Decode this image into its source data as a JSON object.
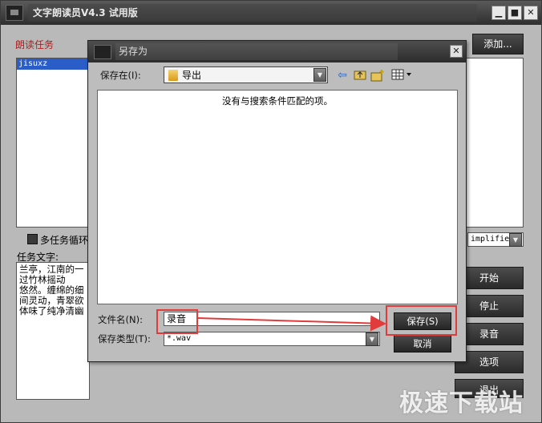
{
  "main_window": {
    "title": "文字朗读员V4.3 试用版",
    "task_section_label": "朗读任务",
    "tasks": [
      "jisuxz"
    ],
    "add_button": "添加...",
    "loop_label": "多任务循环",
    "voice_select_value": "implifie",
    "task_text_label": "任务文字:",
    "task_text": "兰亭，江南的一\n过竹林摇动\n悠然。缠绵的细\n间灵动，青翠欲\n体味了纯净清幽",
    "buttons": {
      "start": "开始",
      "stop": "停止",
      "record": "录音",
      "options": "选项",
      "partial": "退出"
    },
    "window_controls": {
      "minimize": "▁",
      "maximize": "■",
      "close": "✕"
    }
  },
  "dialog": {
    "title": "另存为",
    "close": "✕",
    "save_in_label": "保存在(I):",
    "save_in_value": "导出",
    "empty_message": "没有与搜索条件匹配的项。",
    "filename_label": "文件名(N):",
    "filename_value": "录音",
    "filetype_label": "保存类型(T):",
    "filetype_value": "*.wav",
    "save_button": "保存(S)",
    "cancel_button": "取消",
    "toolbar_icons": [
      "back-icon",
      "up-folder-icon",
      "new-folder-icon",
      "view-menu-icon"
    ]
  },
  "watermark": "极速下载站",
  "colors": {
    "highlight": "#e23b3b",
    "selection": "#2a5dc8"
  }
}
